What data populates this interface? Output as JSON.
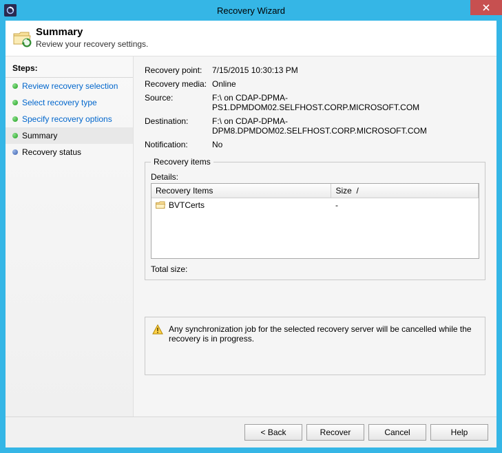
{
  "window": {
    "title": "Recovery Wizard"
  },
  "header": {
    "title": "Summary",
    "subtitle": "Review your recovery settings."
  },
  "sidebar": {
    "steps_label": "Steps:",
    "steps": [
      {
        "label": "Review recovery selection"
      },
      {
        "label": "Select recovery type"
      },
      {
        "label": "Specify recovery options"
      },
      {
        "label": "Summary"
      },
      {
        "label": "Recovery status"
      }
    ]
  },
  "summary": {
    "recovery_point_label": "Recovery point:",
    "recovery_point": "7/15/2015 10:30:13 PM",
    "recovery_media_label": "Recovery media:",
    "recovery_media": "Online",
    "source_label": "Source:",
    "source": "F:\\ on CDAP-DPMA-PS1.DPMDOM02.SELFHOST.CORP.MICROSOFT.COM",
    "destination_label": "Destination:",
    "destination": "F:\\ on CDAP-DPMA-DPM8.DPMDOM02.SELFHOST.CORP.MICROSOFT.COM",
    "notification_label": "Notification:",
    "notification": "No"
  },
  "recovery_items": {
    "legend": "Recovery items",
    "details_label": "Details:",
    "columns": {
      "name": "Recovery Items",
      "size": "Size"
    },
    "rows": [
      {
        "name": "BVTCerts",
        "size": "-"
      }
    ],
    "total_size_label": "Total size:",
    "total_size": ""
  },
  "warning": {
    "text": "Any synchronization job for the selected recovery server will be cancelled while the recovery is in progress."
  },
  "buttons": {
    "back": "< Back",
    "recover": "Recover",
    "cancel": "Cancel",
    "help": "Help"
  }
}
